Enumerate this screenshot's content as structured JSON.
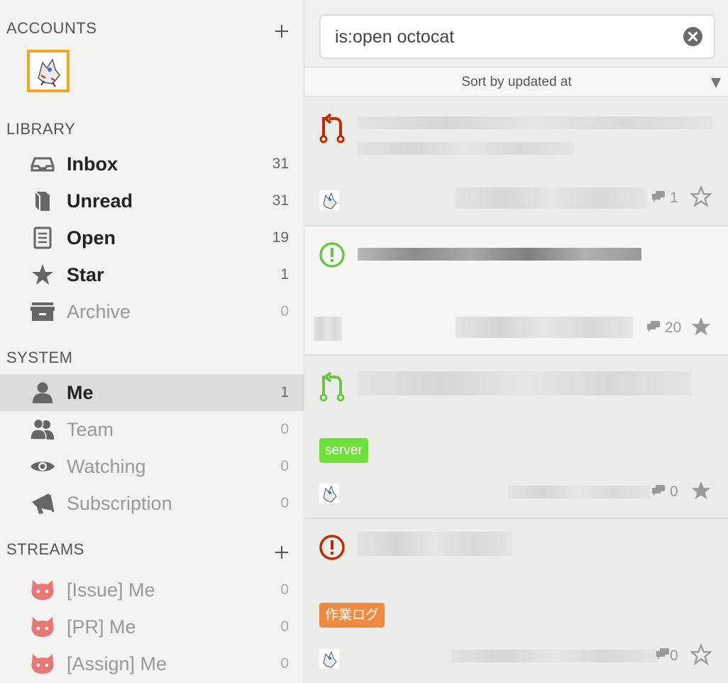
{
  "sidebar": {
    "accounts_title": "ACCOUNTS",
    "library_title": "LIBRARY",
    "system_title": "SYSTEM",
    "streams_title": "STREAMS",
    "library": [
      {
        "label": "Inbox",
        "count": "31",
        "icon": "inbox-icon"
      },
      {
        "label": "Unread",
        "count": "31",
        "icon": "book-icon"
      },
      {
        "label": "Open",
        "count": "19",
        "icon": "document-icon"
      },
      {
        "label": "Star",
        "count": "1",
        "icon": "star-icon"
      },
      {
        "label": "Archive",
        "count": "0",
        "icon": "archive-icon"
      }
    ],
    "system": [
      {
        "label": "Me",
        "count": "1",
        "icon": "person-icon"
      },
      {
        "label": "Team",
        "count": "0",
        "icon": "team-icon"
      },
      {
        "label": "Watching",
        "count": "0",
        "icon": "eye-icon"
      },
      {
        "label": "Subscription",
        "count": "0",
        "icon": "megaphone-icon"
      }
    ],
    "streams": [
      {
        "label": "[Issue] Me",
        "count": "0",
        "icon": "octocat-icon"
      },
      {
        "label": "[PR] Me",
        "count": "0",
        "icon": "octocat-icon"
      },
      {
        "label": "[Assign] Me",
        "count": "0",
        "icon": "octocat-icon"
      }
    ]
  },
  "search": {
    "value": "is:open octocat"
  },
  "sort": {
    "label": "Sort by updated at"
  },
  "items": [
    {
      "type": "pull-request",
      "state": "closed",
      "comments": "1",
      "starred": false,
      "label": ""
    },
    {
      "type": "issue",
      "state": "open",
      "comments": "20",
      "starred": true,
      "label": ""
    },
    {
      "type": "pull-request",
      "state": "open",
      "comments": "0",
      "starred": true,
      "label": "server"
    },
    {
      "type": "issue",
      "state": "closed",
      "comments": "0",
      "starred": false,
      "label": "作業ログ"
    }
  ],
  "colors": {
    "open": "#6cc644",
    "closed": "#bd2c00",
    "label_server": "#6ee03a",
    "label_worklog": "#f08a40",
    "account_border": "#f5a623",
    "octocat": "#e77878"
  }
}
